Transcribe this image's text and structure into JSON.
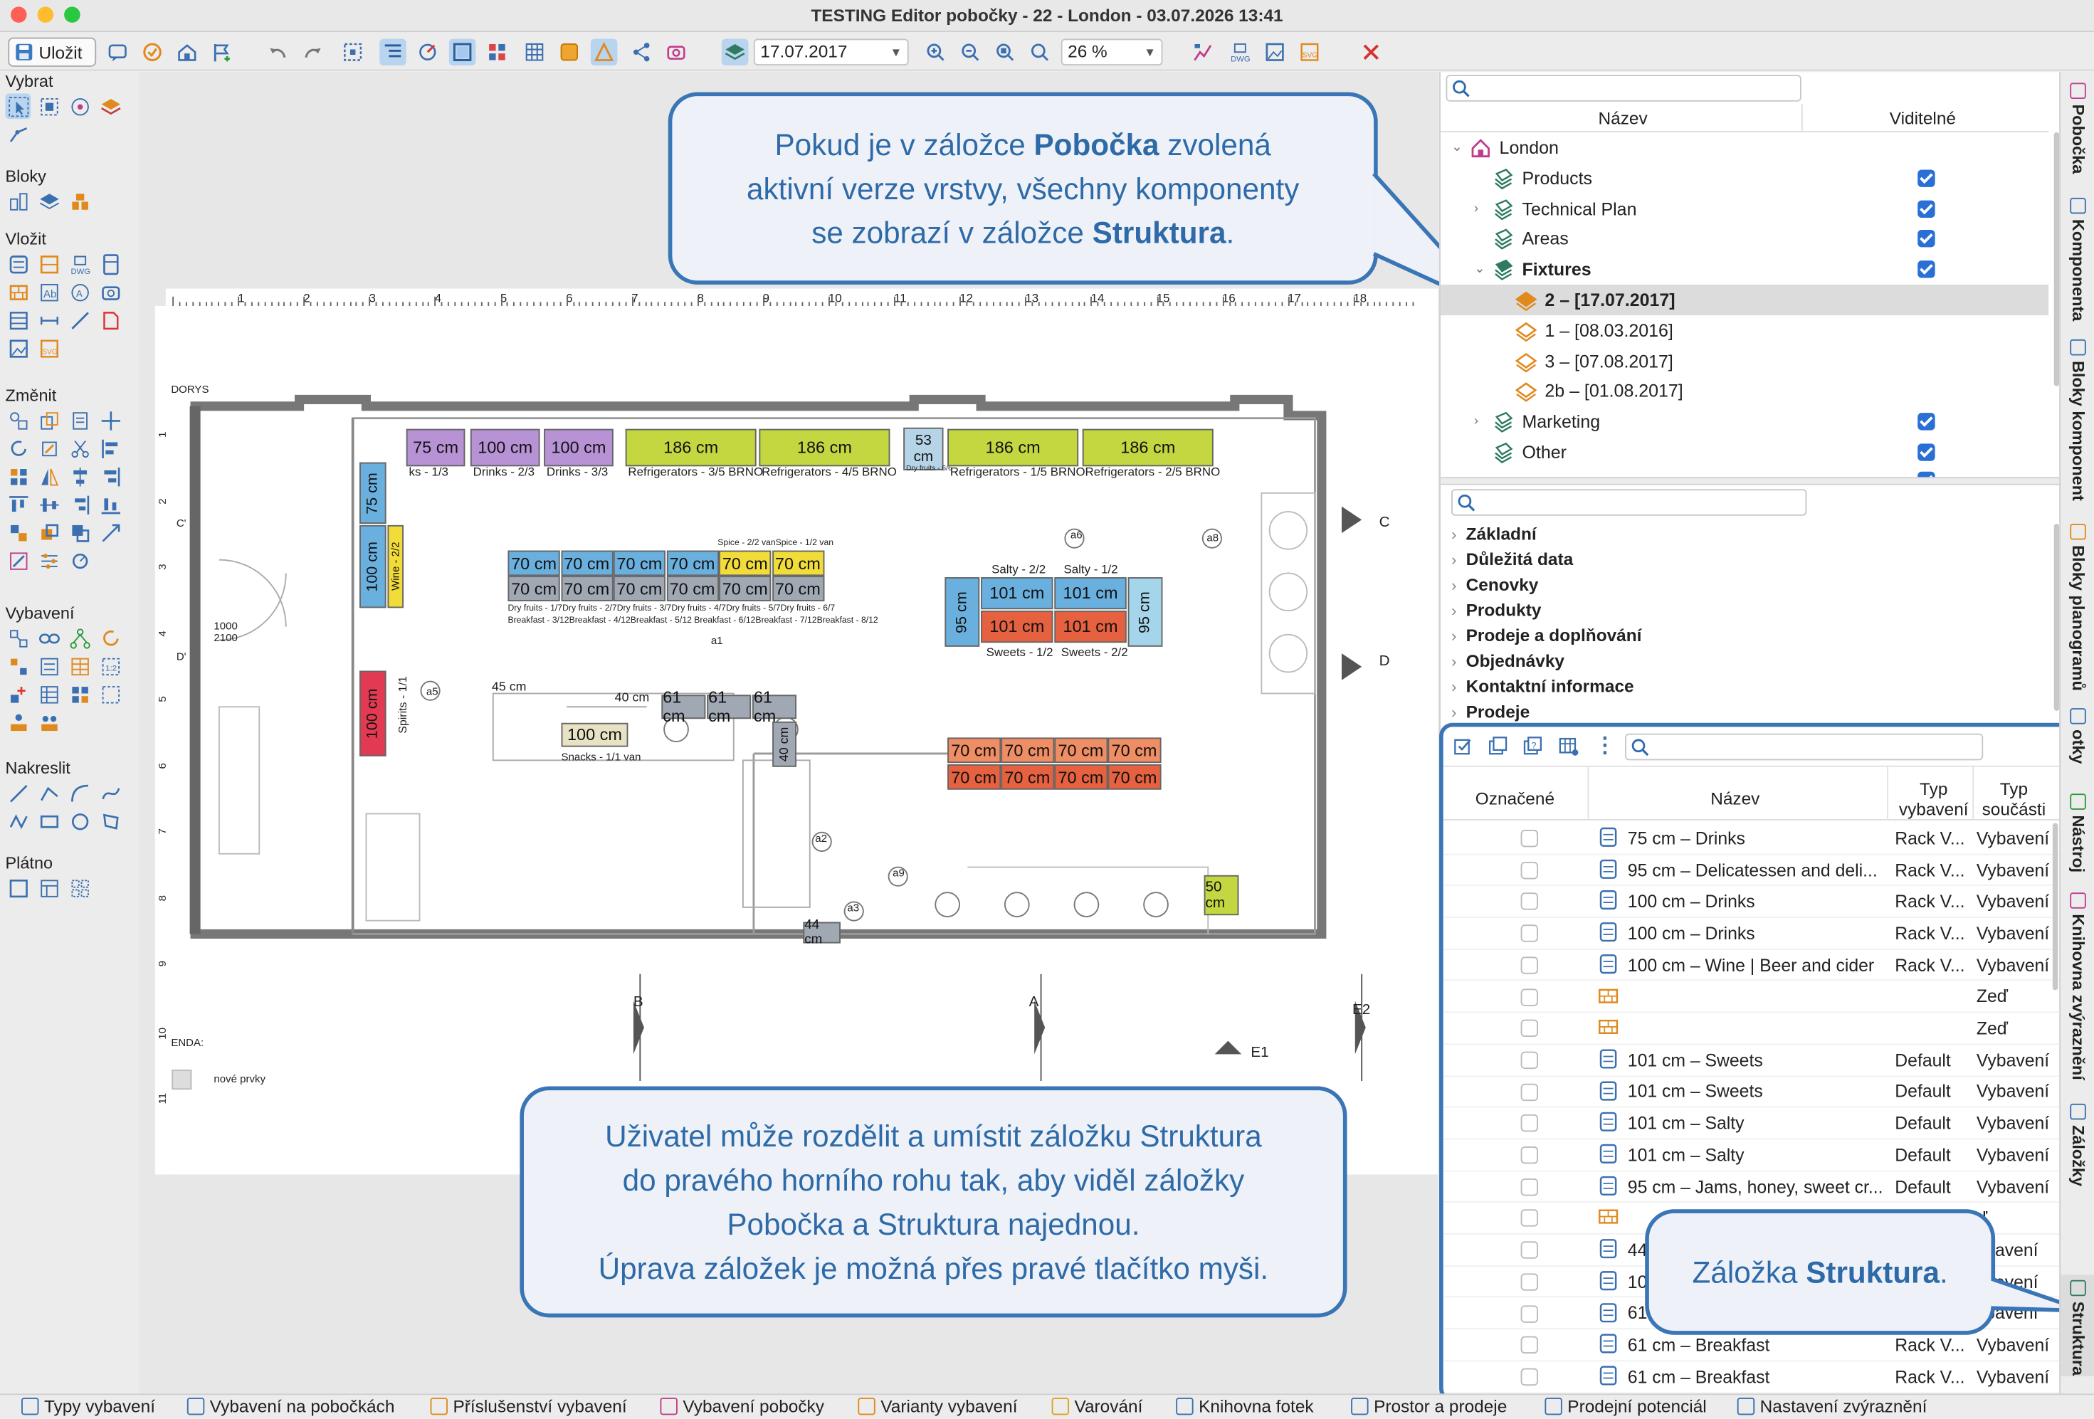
{
  "window": {
    "title": "TESTING Editor pobočky - 22 - London - 03.07.2026 13:41"
  },
  "toolbar": {
    "save_label": "Uložit",
    "date_value": "17.07.2017",
    "zoom_value": "26 %"
  },
  "palette": {
    "groups": [
      "Vybrat",
      "Bloky",
      "Vložit",
      "Změnit",
      "Vybavení",
      "Nakreslit",
      "Plátno"
    ]
  },
  "callouts": {
    "top": {
      "line1_a": "Pokud je v záložce ",
      "line1_b": "Pobočka",
      "line1_c": " zvolená",
      "line2": "aktivní verze vrstvy, všechny komponenty",
      "line3_a": "se zobrazí v záložce ",
      "line3_b": "Struktura",
      "line3_c": "."
    },
    "bottom": {
      "line1": "Uživatel může rozdělit a umístit záložku Struktura",
      "line2": "do pravého horního rohu tak, aby viděl záložky",
      "line3": "Pobočka a Struktura najednou.",
      "line4": "Úprava záložek je možná přes pravé tlačítko myši."
    },
    "right": {
      "text_a": "Záložka ",
      "text_b": "Struktura",
      "text_c": "."
    }
  },
  "floorplan": {
    "ruler": [
      "1",
      "2",
      "3",
      "4",
      "5",
      "6",
      "7",
      "8",
      "9",
      "10",
      "11",
      "12",
      "13",
      "14",
      "15",
      "16",
      "17",
      "18"
    ],
    "vruler": [
      "1",
      "2",
      "3",
      "4",
      "5",
      "6",
      "7",
      "8",
      "9",
      "10",
      "11"
    ],
    "top_bars": [
      {
        "label": "75 cm",
        "sub": "ks - 1/3"
      },
      {
        "label": "100 cm",
        "sub": "Drinks - 2/3"
      },
      {
        "label": "100 cm",
        "sub": "Drinks - 3/3"
      },
      {
        "label": "186 cm",
        "sub": "Refrigerators - 3/5 BRNO"
      },
      {
        "label": "186 cm",
        "sub": "Refrigerators - 4/5 BRNO"
      },
      {
        "label": "53 cm",
        "sub": "Dry fruits - 6/6"
      },
      {
        "label": "186 cm",
        "sub": "Refrigerators - 1/5 BRNO"
      },
      {
        "label": "186 cm",
        "sub": "Refrigerators - 2/5 BRNO"
      }
    ],
    "mid_row1": [
      "70 cm",
      "70 cm",
      "70 cm",
      "70 cm",
      "70 cm",
      "70 cm"
    ],
    "mid_row2": [
      "70 cm",
      "70 cm",
      "70 cm",
      "70 cm",
      "70 cm",
      "70 cm"
    ],
    "mid_sub1": "Dry fruits - 1/7Dry fruits - 2/7Dry fruits - 3/7Dry fruits - 4/7Dry fruits - 5/7Dry fruits - 6/7",
    "mid_sub2": "Breakfast - 3/12Breakfast - 4/12Breakfast - 5/12 Breakfast - 6/12Breakfast - 7/12Breakfast - 8/12",
    "spice": "Spice - 2/2 vanSpice - 1/2 van",
    "island": {
      "salty2": "Salty - 2/2",
      "salty1": "Salty - 1/2",
      "b1": "101 cm",
      "b2": "101 cm",
      "b3": "101 cm",
      "b4": "101 cm",
      "sweets1": "Sweets - 1/2",
      "sweets2": "Sweets - 2/2",
      "side_l": "95 cm",
      "side_r": "95 cm"
    },
    "tea_row1": [
      "70 cm",
      "70 cm",
      "70 cm",
      "70 cm"
    ],
    "tea_row2": [
      "70 cm",
      "70 cm",
      "70 cm",
      "70 cm"
    ],
    "left_bars": [
      {
        "label": "75 cm"
      },
      {
        "label": "100 cm",
        "sub": "Wine - 2/2"
      },
      {
        "label": "100 cm",
        "sub": "Spirits - 1/1"
      }
    ],
    "small": {
      "c45": "45 cm",
      "c40": "40 cm",
      "c61a": "61 cm",
      "c61b": "61 cm",
      "c61c": "61 cm",
      "c40v": "40 cm",
      "c100": "100 cm",
      "snacks": "Snacks - 1/1 van",
      "c44": "44 cm",
      "c50": "50 cm"
    },
    "labels": {
      "a1": "a1",
      "a2": "a2",
      "a3": "a3",
      "a5": "a5",
      "a6": "a6",
      "a8": "a8",
      "a9": "a9",
      "pudorys": "DORYS",
      "legenda": "ENDA:",
      "nove": "nové prvky",
      "e1": "E1",
      "e2": "E2",
      "b": "B",
      "a": "A",
      "c": "C",
      "d": "D",
      "d2": "D'",
      "c2": "C'",
      "d1000": "1000",
      "d2100": "2100"
    }
  },
  "branch_panel": {
    "col_name": "Název",
    "col_visible": "Viditelné",
    "items": [
      {
        "label": "London",
        "level": 0,
        "expand": "v",
        "icon": "house",
        "check": null,
        "bold": false
      },
      {
        "label": "Products",
        "level": 1,
        "expand": "",
        "icon": "layer",
        "check": true,
        "bold": false
      },
      {
        "label": "Technical Plan",
        "level": 1,
        "expand": ">",
        "icon": "layer",
        "check": true,
        "bold": false
      },
      {
        "label": "Areas",
        "level": 1,
        "expand": "",
        "icon": "layer",
        "check": true,
        "bold": false
      },
      {
        "label": "Fixtures",
        "level": 1,
        "expand": "v",
        "icon": "layer-dark",
        "check": true,
        "bold": true
      },
      {
        "label": "2 – [17.07.2017]",
        "level": 2,
        "expand": "",
        "icon": "version-active",
        "check": null,
        "bold": true,
        "selected": true
      },
      {
        "label": "1 – [08.03.2016]",
        "level": 2,
        "expand": "",
        "icon": "version",
        "check": null,
        "bold": false
      },
      {
        "label": "3 – [07.08.2017]",
        "level": 2,
        "expand": "",
        "icon": "version",
        "check": null,
        "bold": false
      },
      {
        "label": "2b – [01.08.2017]",
        "level": 2,
        "expand": "",
        "icon": "version",
        "check": null,
        "bold": false
      },
      {
        "label": "Marketing",
        "level": 1,
        "expand": ">",
        "icon": "layer",
        "check": true,
        "bold": false
      },
      {
        "label": "Other",
        "level": 1,
        "expand": "",
        "icon": "layer",
        "check": true,
        "bold": false
      }
    ]
  },
  "props_panel": {
    "sections": [
      "Základní",
      "Důležitá data",
      "Cenovky",
      "Produkty",
      "Prodeje a doplňování",
      "Objednávky",
      "Kontaktní informace",
      "Prodeje"
    ]
  },
  "structure_panel": {
    "col_marked": "Označené",
    "col_name": "Název",
    "col_type_a": "Typ",
    "col_type_b": "vybavení",
    "col_part_a": "Typ",
    "col_part_b": "součásti",
    "rows": [
      {
        "name": "75 cm – Drinks",
        "type": "Rack V...",
        "part": "Vybavení",
        "icon": "rack"
      },
      {
        "name": "95 cm – Delicatessen and deli...",
        "type": "Rack V...",
        "part": "Vybavení",
        "icon": "rack"
      },
      {
        "name": "100 cm – Drinks",
        "type": "Rack V...",
        "part": "Vybavení",
        "icon": "rack"
      },
      {
        "name": "100 cm – Drinks",
        "type": "Rack V...",
        "part": "Vybavení",
        "icon": "rack"
      },
      {
        "name": "100 cm – Wine | Beer and cider",
        "type": "Rack V...",
        "part": "Vybavení",
        "icon": "rack"
      },
      {
        "name": "",
        "type": "",
        "part": "Zeď",
        "icon": "wall"
      },
      {
        "name": "",
        "type": "",
        "part": "Zeď",
        "icon": "wall"
      },
      {
        "name": "101 cm – Sweets",
        "type": "Default",
        "part": "Vybavení",
        "icon": "rack"
      },
      {
        "name": "101 cm – Sweets",
        "type": "Default",
        "part": "Vybavení",
        "icon": "rack"
      },
      {
        "name": "101 cm – Salty",
        "type": "Default",
        "part": "Vybavení",
        "icon": "rack"
      },
      {
        "name": "101 cm – Salty",
        "type": "Default",
        "part": "Vybavení",
        "icon": "rack"
      },
      {
        "name": "95 cm – Jams, honey, sweet cr...",
        "type": "Default",
        "part": "Vybavení",
        "icon": "rack"
      },
      {
        "name": "",
        "type": "",
        "part": "ď",
        "icon": "wall"
      },
      {
        "name": "44",
        "type": "",
        "part": "ybavení",
        "icon": "rack"
      },
      {
        "name": "10",
        "type": "",
        "part": "ybavení",
        "icon": "rack"
      },
      {
        "name": "61",
        "type": "",
        "part": "ybavení",
        "icon": "rack"
      },
      {
        "name": "61 cm – Breakfast",
        "type": "Rack V...",
        "part": "Vybavení",
        "icon": "rack"
      },
      {
        "name": "61 cm – Breakfast",
        "type": "Rack V...",
        "part": "Vybavení",
        "icon": "rack"
      }
    ]
  },
  "side_tabs": [
    "Pobočka",
    "Komponenta",
    "Bloky komponent",
    "Bloky planogramů",
    "otky",
    "Nástroj",
    "Knihovna zvýraznění",
    "Záložky",
    "Struktura"
  ],
  "bottom_tabs": [
    "Typy vybavení",
    "Vybavení na pobočkách",
    "Příslušenství vybavení",
    "Vybavení pobočky",
    "Varianty vybavení",
    "Varování",
    "Knihovna fotek",
    "Prostor a prodeje",
    "Prodejní potenciál",
    "Nastavení zvýraznění"
  ]
}
